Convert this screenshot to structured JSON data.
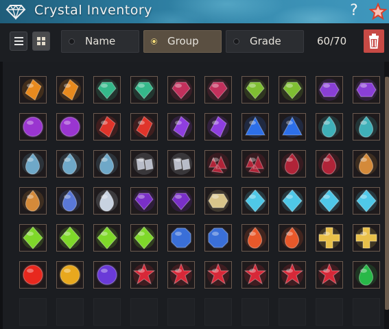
{
  "window": {
    "title": "Crystal Inventory",
    "help_label": "?",
    "title_icon": "diamond-icon",
    "favorite_icon": "star-icon"
  },
  "filter": {
    "view_modes": [
      {
        "name": "list-view",
        "icon": "list-icon",
        "active": false
      },
      {
        "name": "grid-view",
        "icon": "grid-icon",
        "active": true
      }
    ],
    "sort_options": [
      {
        "label": "Name",
        "selected": false
      },
      {
        "label": "Group",
        "selected": true
      },
      {
        "label": "Grade",
        "selected": false
      }
    ],
    "count": "60/70",
    "delete_icon": "trash-icon"
  },
  "inventory": {
    "columns": 10,
    "rows": [
      [
        {
          "icon": "orange-shard-crystal",
          "color": "#e88a1e"
        },
        {
          "icon": "orange-shard-crystal",
          "color": "#e88a1e"
        },
        {
          "icon": "green-cyan-gem-crystal",
          "color": "#35b88a"
        },
        {
          "icon": "green-cyan-gem-crystal",
          "color": "#35b88a"
        },
        {
          "icon": "magenta-gem-crystal",
          "color": "#c2305c"
        },
        {
          "icon": "magenta-gem-crystal",
          "color": "#c2305c"
        },
        {
          "icon": "lime-gem-crystal",
          "color": "#7fbf32"
        },
        {
          "icon": "lime-gem-crystal",
          "color": "#7fbf32"
        },
        {
          "icon": "purple-hexagon-crystal",
          "color": "#8a3fd6"
        },
        {
          "icon": "purple-hexagon-crystal",
          "color": "#8a3fd6"
        }
      ],
      [
        {
          "icon": "purple-orb-crystal",
          "color": "#9a35d0"
        },
        {
          "icon": "purple-orb-crystal",
          "color": "#9a35d0"
        },
        {
          "icon": "red-shard-crystal",
          "color": "#e0342a"
        },
        {
          "icon": "red-shard-crystal",
          "color": "#e0342a"
        },
        {
          "icon": "violet-shard-crystal",
          "color": "#8f3ee0"
        },
        {
          "icon": "violet-shard-crystal",
          "color": "#8f3ee0"
        },
        {
          "icon": "blue-triangle-crystal",
          "color": "#2d6fe8"
        },
        {
          "icon": "blue-triangle-crystal",
          "color": "#2d6fe8"
        },
        {
          "icon": "teal-drop-crystal",
          "color": "#3fb0b8"
        },
        {
          "icon": "teal-drop-crystal",
          "color": "#3fb0b8"
        }
      ],
      [
        {
          "icon": "steel-drop-crystal",
          "color": "#6fa8c8"
        },
        {
          "icon": "steel-drop-crystal",
          "color": "#6fa8c8"
        },
        {
          "icon": "steel-drop-crystal",
          "color": "#6fa8c8"
        },
        {
          "icon": "silver-twin-crystal",
          "color": "#b8bcc8"
        },
        {
          "icon": "silver-twin-crystal",
          "color": "#b8bcc8"
        },
        {
          "icon": "crimson-cluster-crystal",
          "color": "#b02438"
        },
        {
          "icon": "crimson-cluster-crystal",
          "color": "#b02438"
        },
        {
          "icon": "crimson-drop-crystal",
          "color": "#b02438"
        },
        {
          "icon": "crimson-drop-crystal",
          "color": "#b02438"
        },
        {
          "icon": "amber-drop-crystal",
          "color": "#d48a3a"
        }
      ],
      [
        {
          "icon": "amber-drop-crystal",
          "color": "#d48a3a"
        },
        {
          "icon": "blue-drop-crystal",
          "color": "#5a78d8"
        },
        {
          "icon": "white-drop-crystal",
          "color": "#c8d2e0"
        },
        {
          "icon": "purple-gem-crystal",
          "color": "#7a2fc8"
        },
        {
          "icon": "purple-gem-crystal",
          "color": "#7a2fc8"
        },
        {
          "icon": "gold-hexagon-crystal",
          "color": "#d8c48a"
        },
        {
          "icon": "cyan-diamond-crystal",
          "color": "#4fc8e8"
        },
        {
          "icon": "cyan-diamond-crystal",
          "color": "#4fc8e8"
        },
        {
          "icon": "cyan-diamond-crystal",
          "color": "#4fc8e8"
        },
        {
          "icon": "cyan-diamond-crystal",
          "color": "#4fc8e8"
        }
      ],
      [
        {
          "icon": "green-diamond-crystal",
          "color": "#7fd82a"
        },
        {
          "icon": "green-diamond-crystal",
          "color": "#7fd82a"
        },
        {
          "icon": "green-diamond-crystal",
          "color": "#7fd82a"
        },
        {
          "icon": "green-diamond-crystal",
          "color": "#7fd82a"
        },
        {
          "icon": "blue-octagon-crystal",
          "color": "#3a6fd8"
        },
        {
          "icon": "blue-octagon-crystal",
          "color": "#3a6fd8"
        },
        {
          "icon": "orange-drop-crystal",
          "color": "#e8582a"
        },
        {
          "icon": "orange-drop-crystal",
          "color": "#e8582a"
        },
        {
          "icon": "gold-cross-crystal",
          "color": "#e8c04a"
        },
        {
          "icon": "gold-cross-crystal",
          "color": "#e8c04a"
        }
      ],
      [
        {
          "icon": "red-orb-crystal",
          "color": "#e8281e"
        },
        {
          "icon": "gold-orb-crystal",
          "color": "#e8a81e"
        },
        {
          "icon": "violet-orb-crystal",
          "color": "#6a3ad8"
        },
        {
          "icon": "red-star-crystal",
          "color": "#d82838"
        },
        {
          "icon": "red-star-crystal",
          "color": "#d82838"
        },
        {
          "icon": "red-star-crystal",
          "color": "#d82838"
        },
        {
          "icon": "red-star-crystal",
          "color": "#d82838"
        },
        {
          "icon": "red-star-crystal",
          "color": "#d82838"
        },
        {
          "icon": "red-star-crystal",
          "color": "#d82838"
        },
        {
          "icon": "emerald-drop-crystal",
          "color": "#28b848"
        }
      ],
      [
        {
          "icon": "",
          "color": ""
        },
        {
          "icon": "",
          "color": ""
        },
        {
          "icon": "",
          "color": ""
        },
        {
          "icon": "",
          "color": ""
        },
        {
          "icon": "",
          "color": ""
        },
        {
          "icon": "",
          "color": ""
        },
        {
          "icon": "",
          "color": ""
        },
        {
          "icon": "",
          "color": ""
        },
        {
          "icon": "",
          "color": ""
        },
        {
          "icon": "",
          "color": ""
        }
      ]
    ]
  }
}
